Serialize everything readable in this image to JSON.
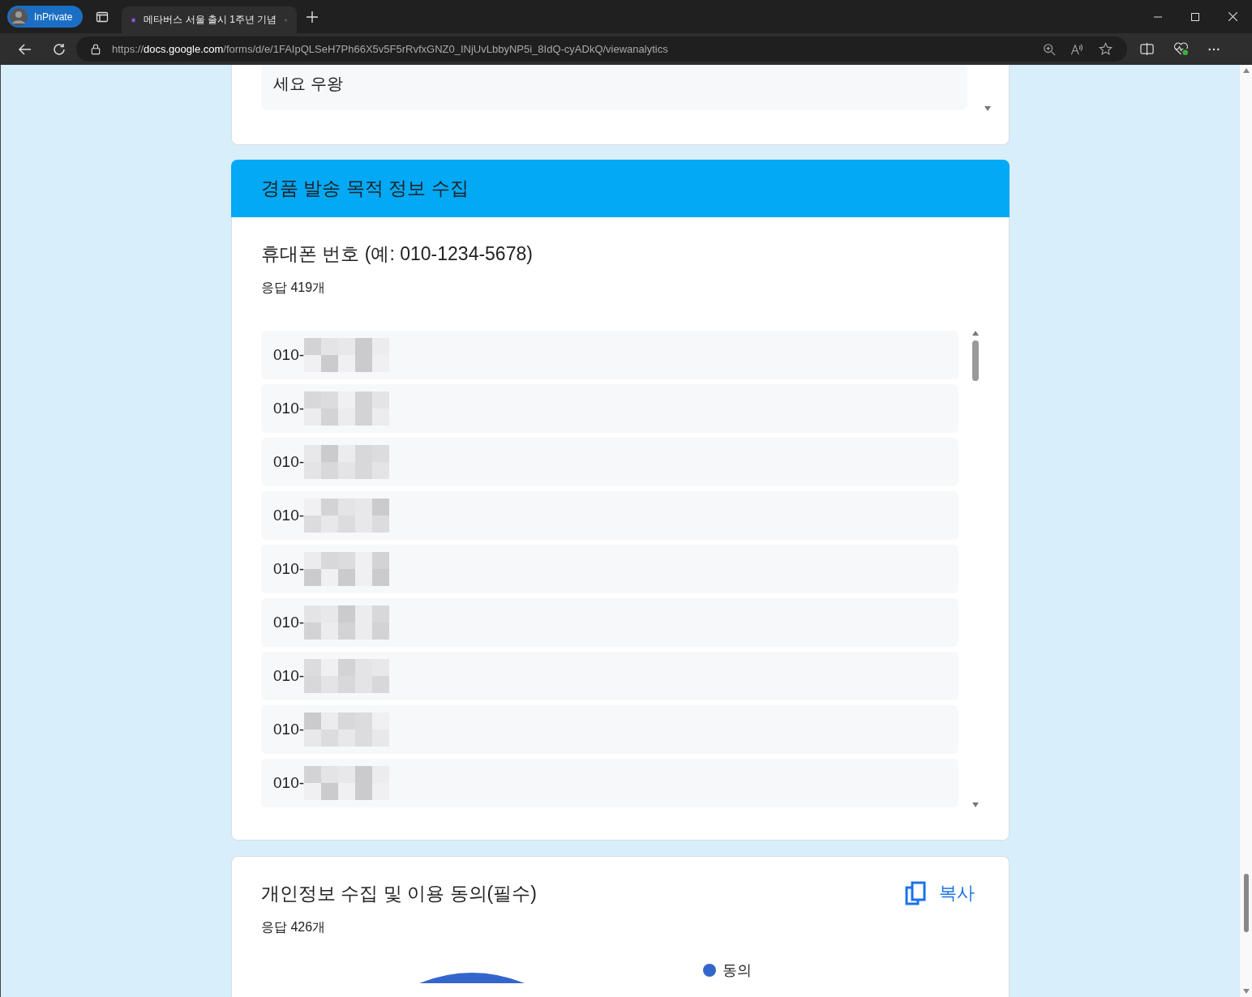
{
  "browser": {
    "profile": "InPrivate",
    "tab_title": "메타버스 서울 출시 1주년 기념",
    "url_scheme": "https://",
    "url_host": "docs.google.com",
    "url_path": "/forms/d/e/1FAIpQLSeH7Ph66X5v5F5rRvfxGNZ0_INjUvLbbyNP5i_8IdQ-cyADkQ/viewanalytics"
  },
  "previous_answer": {
    "text": "세요 우왕"
  },
  "section": {
    "title": "경품 발송 목적 정보 수집"
  },
  "phone_question": {
    "title": "휴대폰 번호 (예: 010-1234-5678)",
    "count": "응답 419개",
    "responses": [
      "010-",
      "010-",
      "010-",
      "010-",
      "010-",
      "010-",
      "010-",
      "010-",
      "010-"
    ]
  },
  "consent_question": {
    "title": "개인정보 수집 및 이용 동의(필수)",
    "count": "응답 426개",
    "copy_button": "복사",
    "legend": [
      {
        "label": "동의",
        "color": "#3366cc"
      }
    ]
  }
}
